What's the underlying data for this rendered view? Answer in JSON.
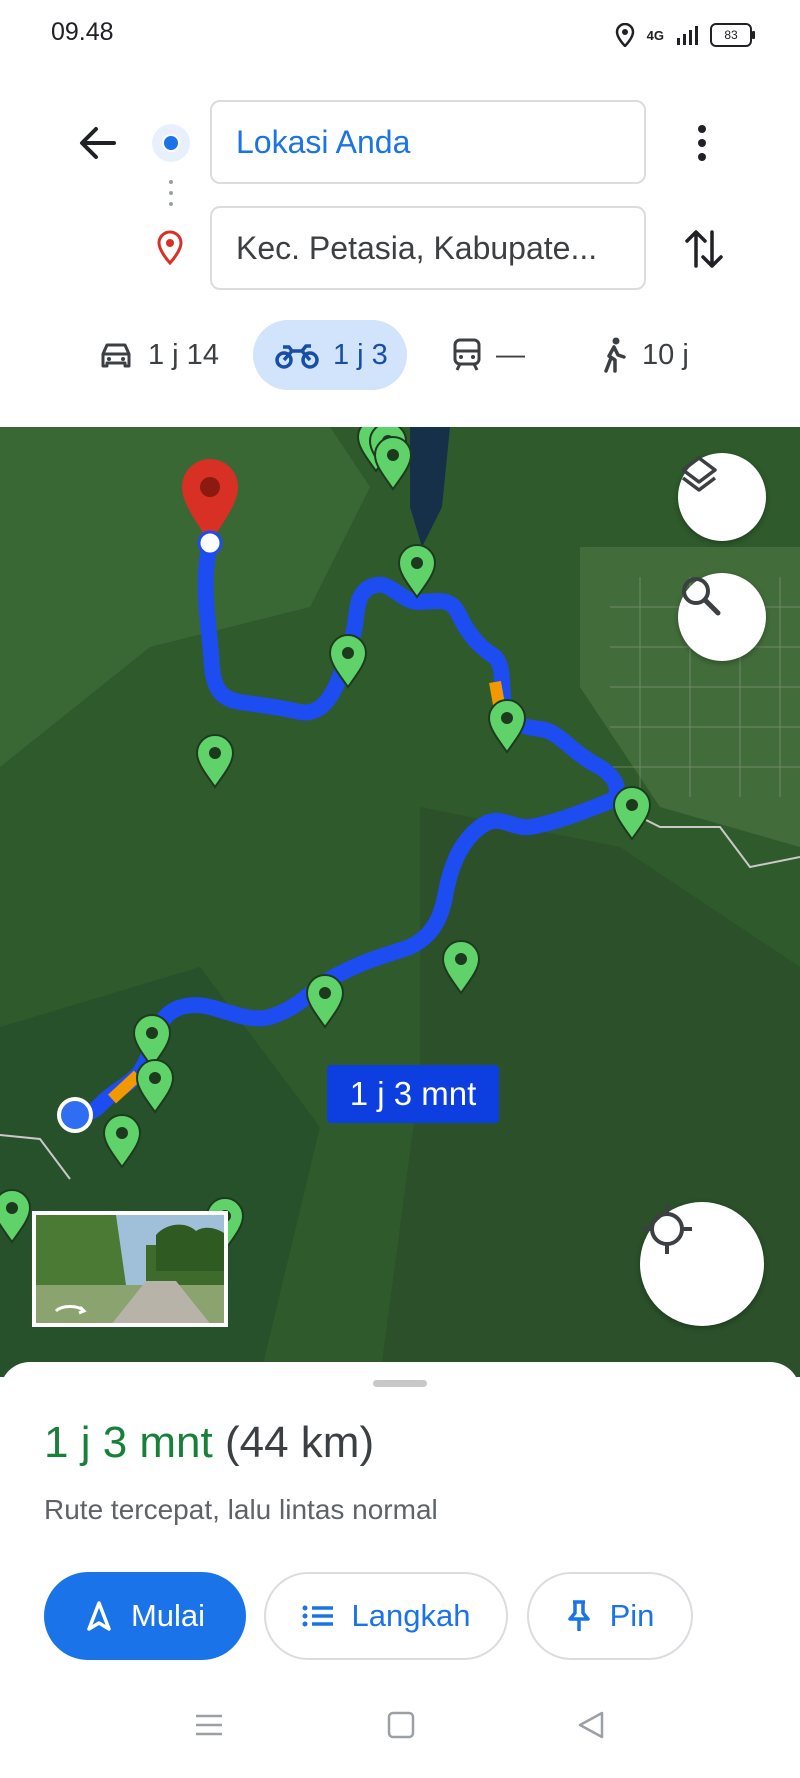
{
  "status_bar": {
    "time": "09.48",
    "network": "4G",
    "battery": "83"
  },
  "directions": {
    "origin": "Lokasi Anda",
    "destination": "Kec. Petasia, Kabupate..."
  },
  "modes": [
    {
      "name": "car",
      "label": "1 j 14"
    },
    {
      "name": "motorcycle",
      "label": "1 j 3",
      "selected": true
    },
    {
      "name": "transit",
      "label": "—"
    },
    {
      "name": "walk",
      "label": "10 j"
    }
  ],
  "map": {
    "route_label": "1 j 3 mnt",
    "colors": {
      "route": "#1d4cf0",
      "traffic": "#f29900",
      "pins": "#5fd36a",
      "destination_pin": "#d93025"
    }
  },
  "sheet": {
    "duration": "1 j 3 mnt",
    "distance": "(44 km)",
    "description": "Rute tercepat, lalu lintas normal",
    "buttons": {
      "start": "Mulai",
      "steps": "Langkah",
      "pin": "Pin"
    }
  },
  "icons": [
    "arrow-back-icon",
    "more-vert-icon",
    "swap-icon",
    "car-icon",
    "motorcycle-icon",
    "transit-icon",
    "walk-icon",
    "layers-icon",
    "search-icon",
    "locate-icon",
    "navigation-icon",
    "list-icon",
    "pin-icon"
  ]
}
